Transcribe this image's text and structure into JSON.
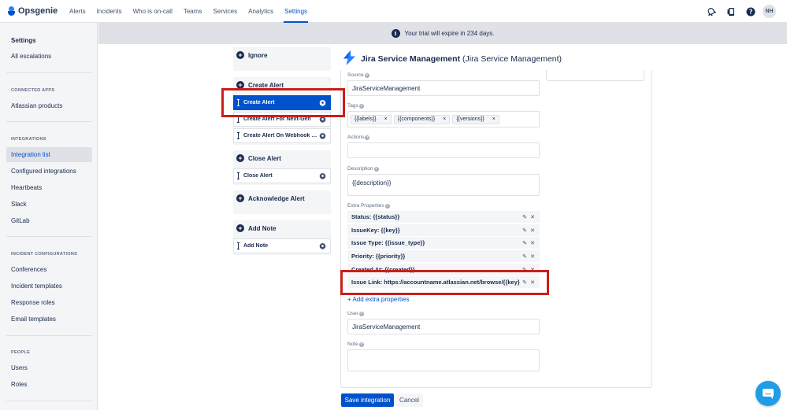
{
  "app": {
    "name": "Opsgenie"
  },
  "nav": {
    "items": [
      "Alerts",
      "Incidents",
      "Who is on-call",
      "Teams",
      "Services",
      "Analytics",
      "Settings"
    ],
    "active": "Settings",
    "user_initials": "NH"
  },
  "sidebar": {
    "top": [
      {
        "label": "Settings",
        "bold": true
      },
      {
        "label": "All escalations"
      }
    ],
    "sections": [
      {
        "heading": "CONNECTED APPS",
        "items": [
          "Atlassian products"
        ]
      },
      {
        "heading": "INTEGRATIONS",
        "items": [
          "Integration list",
          "Configured integrations",
          "Heartbeats",
          "Slack",
          "GitLab"
        ],
        "selected": "Integration list"
      },
      {
        "heading": "INCIDENT CONFIGURATIONS",
        "items": [
          "Conferences",
          "Incident templates",
          "Response roles",
          "Email templates"
        ]
      },
      {
        "heading": "PEOPLE",
        "items": [
          "Users",
          "Roles"
        ]
      }
    ]
  },
  "banner": {
    "text": "Your trial will expire in 234 days."
  },
  "actions": {
    "groups": [
      {
        "title": "Ignore",
        "items": []
      },
      {
        "title": "Create Alert",
        "items": [
          "Create Alert",
          "Create Alert For Next-Gen",
          "Create Alert On Webhook Rec"
        ]
      },
      {
        "title": "Close Alert",
        "items": [
          "Close Alert"
        ]
      },
      {
        "title": "Acknowledge Alert",
        "items": []
      },
      {
        "title": "Add Note",
        "items": [
          "Add Note"
        ]
      }
    ],
    "selected": "Create Alert"
  },
  "integration": {
    "title_bold": "Jira Service Management",
    "title_rest": "(Jira Service Management)"
  },
  "form": {
    "source": {
      "label": "Source",
      "value": "JiraServiceManagement"
    },
    "tags": {
      "label": "Tags",
      "values": [
        "{{labels}}",
        "{{components}}",
        "{{versions}}"
      ],
      "remove": "×"
    },
    "actions": {
      "label": "Actions",
      "value": ""
    },
    "description": {
      "label": "Description",
      "value": "{{description}}"
    },
    "extra": {
      "label": "Extra Properties",
      "items": [
        "Status: {{status}}",
        "IssueKey: {{key}}",
        "Issue Type: {{issue_type}}",
        "Priority: {{priority}}",
        "Created At: {{created}}",
        "Issue Link: https://accountname.atlassian.net/browse/{{key}}"
      ],
      "add_label": "+ Add extra properties"
    },
    "user": {
      "label": "User",
      "value": "JiraServiceManagement"
    },
    "note": {
      "label": "Note",
      "value": ""
    }
  },
  "buttons": {
    "save": "Save integration",
    "cancel": "Cancel"
  },
  "colors": {
    "primary": "#0052cc",
    "highlight": "#c8201a",
    "chat": "#1f9de6"
  }
}
